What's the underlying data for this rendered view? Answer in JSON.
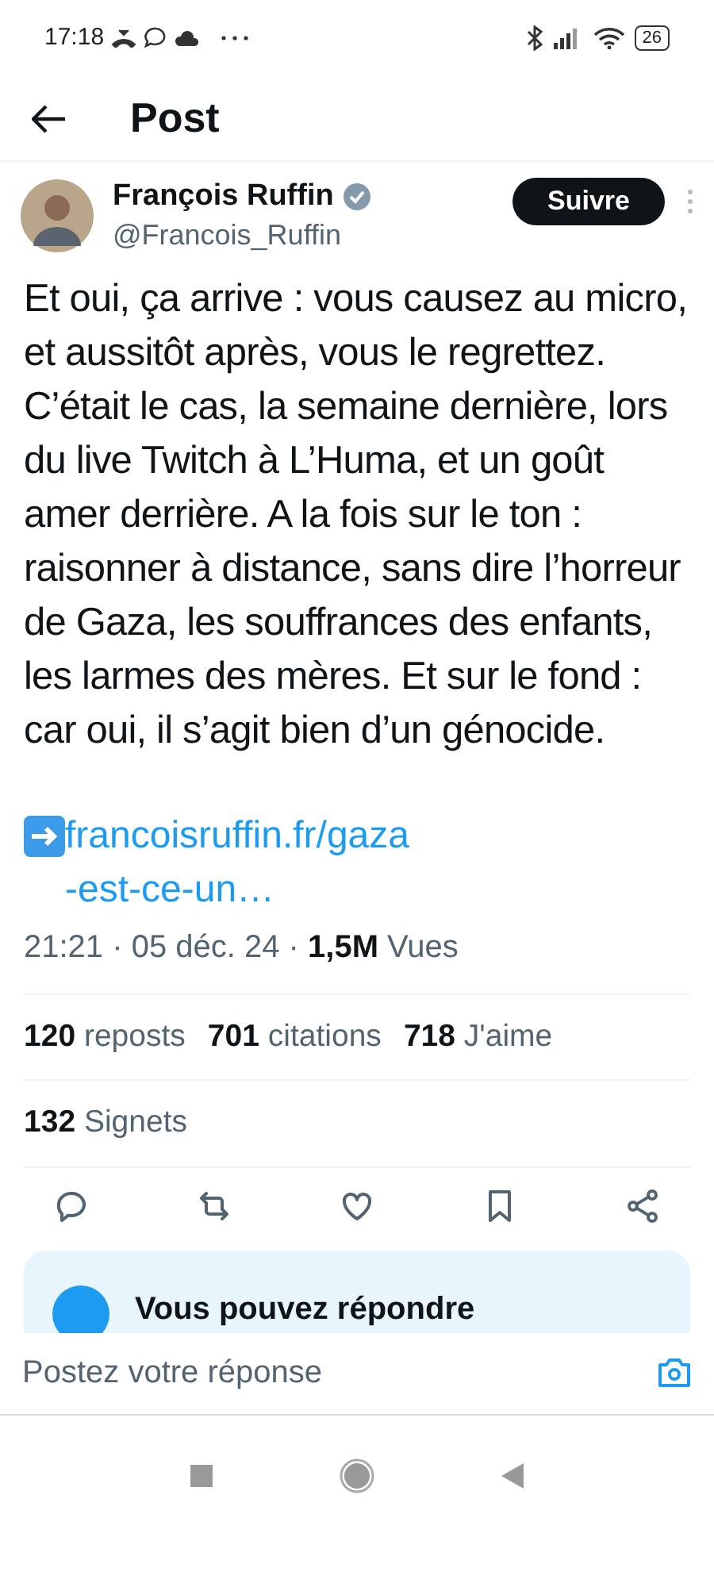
{
  "status_bar": {
    "time": "17:18",
    "battery": "26"
  },
  "header": {
    "title": "Post"
  },
  "author": {
    "name": "François Ruffin",
    "verified": true,
    "handle": "@Francois_Ruffin",
    "follow_label": "Suivre"
  },
  "body": "Et oui, ça arrive : vous causez au micro, et aussitôt après, vous le regrettez. C’était le cas, la semaine dernière, lors du live Twitch à L’Huma, et un goût amer derrière. A la fois sur le ton : raisonner à distance, sans dire l’horreur de Gaza, les souffrances des enfants, les larmes des mères. Et sur le fond : car oui, il s’agit bien d’un génocide.",
  "link": "francoisruffin.fr/gaza-est-ce-un…",
  "meta": {
    "date": "21:21 · 05 déc. 24 ·",
    "views": "1,5M",
    "views_label": "Vues"
  },
  "stats": [
    {
      "count": "120",
      "label": "reposts"
    },
    {
      "count": "701",
      "label": "citations"
    },
    {
      "count": "718",
      "label": "J'aime"
    }
  ],
  "stats_row2": [
    {
      "count": "132",
      "label": "Signets"
    }
  ],
  "actions": [
    {
      "kind": "reply"
    },
    {
      "kind": "repost"
    },
    {
      "kind": "like"
    },
    {
      "kind": "bookmark"
    },
    {
      "kind": "share"
    }
  ],
  "banner": {
    "text": "Vous pouvez répondre"
  },
  "reply_field": {
    "placeholder": "Postez votre réponse"
  }
}
